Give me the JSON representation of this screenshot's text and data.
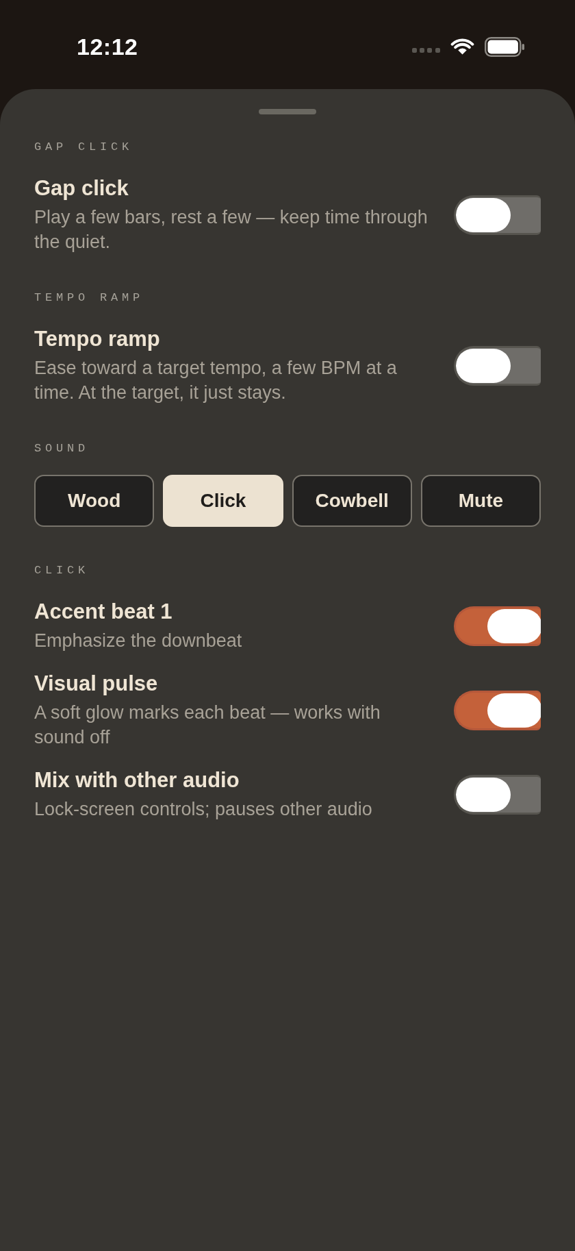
{
  "status_bar": {
    "time": "12:12"
  },
  "sheet": {
    "sections": [
      {
        "label": "GAP CLICK",
        "kind": "toggles",
        "rows": [
          {
            "title": "Gap click",
            "description": "Play a few bars, rest a few — keep time through the quiet.",
            "on": false
          }
        ]
      },
      {
        "label": "TEMPO RAMP",
        "kind": "toggles",
        "rows": [
          {
            "title": "Tempo ramp",
            "description": "Ease toward a target tempo, a few BPM at a time. At the target, it just stays.",
            "on": false
          }
        ]
      },
      {
        "label": "SOUND",
        "kind": "segments",
        "options": [
          {
            "label": "Wood",
            "selected": false
          },
          {
            "label": "Click",
            "selected": true
          },
          {
            "label": "Cowbell",
            "selected": false
          },
          {
            "label": "Mute",
            "selected": false
          }
        ]
      },
      {
        "label": "CLICK",
        "kind": "toggles",
        "rows": [
          {
            "title": "Accent beat 1",
            "description": "Emphasize the downbeat",
            "on": true
          },
          {
            "title": "Visual pulse",
            "description": "A soft glow marks each beat — works with sound off",
            "on": true
          },
          {
            "title": "Mix with other audio",
            "description": "Lock-screen controls; pauses other audio",
            "on": false
          }
        ]
      }
    ]
  }
}
